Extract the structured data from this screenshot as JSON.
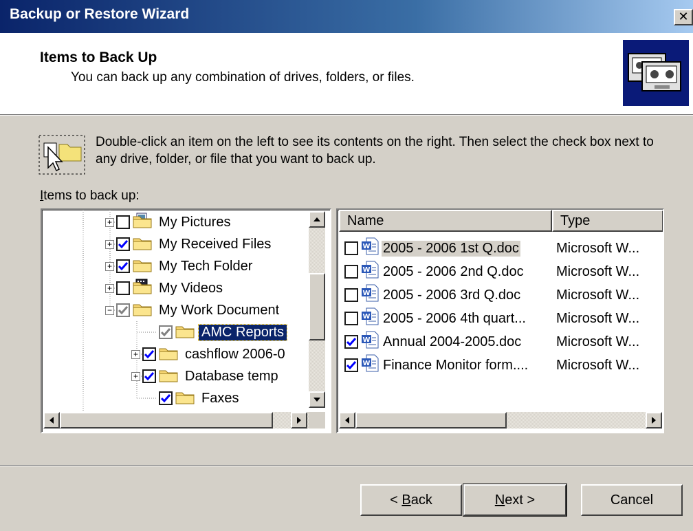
{
  "window": {
    "title": "Backup or Restore Wizard",
    "close_glyph": "✕"
  },
  "header": {
    "title": "Items to Back Up",
    "subtitle": "You can back up any combination of drives, folders, or files.",
    "logo_icon": "backup-tapes-icon"
  },
  "instruction": "Double-click an item on the left to see its contents on the right. Then select the check box next to any drive, folder, or file that you want to back up.",
  "items_label": {
    "underlined": "I",
    "rest": "tems to back up:"
  },
  "tree": {
    "items": [
      {
        "label": "My Pictures",
        "expander": "+",
        "checked": "none",
        "icon": "pictures-folder-icon"
      },
      {
        "label": "My Received Files",
        "expander": "+",
        "checked": "checked",
        "icon": "folder-icon"
      },
      {
        "label": "My Tech Folder",
        "expander": "+",
        "checked": "checked",
        "icon": "folder-icon"
      },
      {
        "label": "My Videos",
        "expander": "+",
        "checked": "none",
        "icon": "videos-folder-icon"
      },
      {
        "label": "My Work Document",
        "expander": "−",
        "checked": "partial",
        "icon": "folder-icon"
      },
      {
        "label": "AMC Reports",
        "expander": "",
        "checked": "partial",
        "icon": "folder-icon",
        "selected": true
      },
      {
        "label": "cashflow 2006-0",
        "expander": "+",
        "checked": "checked",
        "icon": "folder-icon"
      },
      {
        "label": "Database temp",
        "expander": "+",
        "checked": "checked",
        "icon": "folder-icon"
      },
      {
        "label": "Faxes",
        "expander": "",
        "checked": "checked",
        "icon": "folder-icon"
      }
    ]
  },
  "list": {
    "columns": {
      "name": "Name",
      "type": "Type"
    },
    "rows": [
      {
        "name": "2005 - 2006 1st Q.doc",
        "type": "Microsoft W...",
        "checked": false,
        "highlight": true
      },
      {
        "name": "2005 - 2006 2nd Q.doc",
        "type": "Microsoft W...",
        "checked": false
      },
      {
        "name": "2005 - 2006 3rd Q.doc",
        "type": "Microsoft W...",
        "checked": false
      },
      {
        "name": "2005 - 2006 4th quart...",
        "type": "Microsoft W...",
        "checked": false
      },
      {
        "name": "Annual 2004-2005.doc",
        "type": "Microsoft W...",
        "checked": true
      },
      {
        "name": "Finance Monitor form....",
        "type": "Microsoft W...",
        "checked": true
      }
    ]
  },
  "buttons": {
    "back": {
      "prefix": "< ",
      "mnemonic": "B",
      "rest": "ack"
    },
    "next": {
      "mnemonic": "N",
      "rest": "ext >"
    },
    "cancel": "Cancel"
  },
  "colors": {
    "title_start": "#0a246a",
    "title_end": "#a6caf0",
    "face": "#d4d0c8",
    "selection": "#0a246a",
    "check": "#0000ff"
  }
}
